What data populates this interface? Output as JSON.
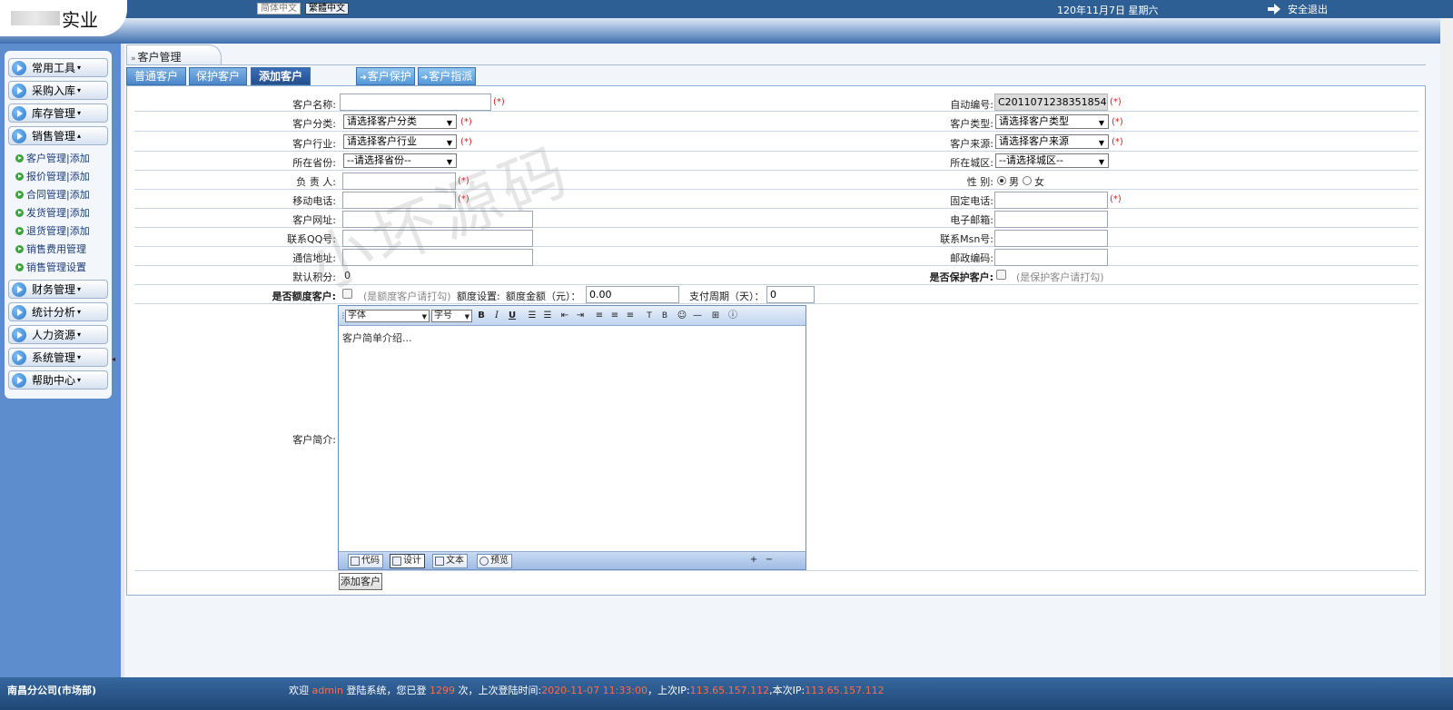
{
  "header": {
    "brand": "实业",
    "lang_simplified": "简体中文",
    "lang_traditional": "繁體中文",
    "date": "120年11月7日 星期六",
    "logout": "安全退出"
  },
  "sidebar": {
    "menus": [
      {
        "label": "常用工具",
        "caret": "▾"
      },
      {
        "label": "采购入库",
        "caret": "▾"
      },
      {
        "label": "库存管理",
        "caret": "▾"
      },
      {
        "label": "销售管理",
        "caret": "▴"
      }
    ],
    "sub_items": [
      "客户管理|添加",
      "报价管理|添加",
      "合同管理|添加",
      "发货管理|添加",
      "退货管理|添加",
      "销售费用管理",
      "销售管理设置"
    ],
    "menus_after": [
      {
        "label": "财务管理",
        "caret": "▾"
      },
      {
        "label": "统计分析",
        "caret": "▾"
      },
      {
        "label": "人力资源",
        "caret": "▾"
      },
      {
        "label": "系统管理",
        "caret": "▾"
      },
      {
        "label": "帮助中心",
        "caret": "▾"
      }
    ]
  },
  "breadcrumb": {
    "label": "客户管理"
  },
  "tabs": {
    "normal": "普通客户",
    "protected": "保护客户",
    "add": "添加客户",
    "protect": "客户保护",
    "assign": "客户指派"
  },
  "form": {
    "customer_name_label": "客户名称:",
    "auto_no_label": "自动编号:",
    "auto_no_value": "C2011071238351854",
    "category_label": "客户分类:",
    "category_value": "请选择客户分类",
    "type_label": "客户类型:",
    "type_value": "请选择客户类型",
    "industry_label": "客户行业:",
    "industry_value": "请选择客户行业",
    "source_label": "客户来源:",
    "source_value": "请选择客户来源",
    "province_label": "所在省份:",
    "province_value": "--请选择省份--",
    "city_label": "所在城区:",
    "city_value": "--请选择城区--",
    "owner_label": "负 责 人:",
    "gender_label": "性 别:",
    "gender_male": "男",
    "gender_female": "女",
    "mobile_label": "移动电话:",
    "phone_label": "固定电话:",
    "website_label": "客户网址:",
    "email_label": "电子邮箱:",
    "qq_label": "联系QQ号:",
    "msn_label": "联系Msn号:",
    "address_label": "通信地址:",
    "postcode_label": "邮政编码:",
    "points_label": "默认积分:",
    "points_value": "0",
    "is_protected_label": "是否保护客户:",
    "is_protected_hint": "(是保护客户请打勾)",
    "is_quota_label": "是否额度客户:",
    "is_quota_hint": "(是额度客户请打勾)",
    "quota_setting": "额度设置:",
    "quota_amount_label": "额度金额（元）：",
    "quota_amount_value": "0.00",
    "pay_cycle_label": "支付周期（天）：",
    "pay_cycle_value": "0",
    "intro_label": "客户简介:",
    "required": "(*)",
    "submit": "添加客户"
  },
  "editor": {
    "font": "字体",
    "size": "字号",
    "placeholder": "客户简单介绍...",
    "mode_code": "代码",
    "mode_design": "设计",
    "mode_text": "文本",
    "mode_preview": "预览"
  },
  "watermark": "小坏源码",
  "footer": {
    "company": "南昌分公司(市场部)",
    "welcome": "欢迎",
    "user": "admin",
    "login_text": "登陆系统，您已登",
    "login_count": "1299",
    "count_suffix": "次，上次登陆时间:",
    "last_time": "2020-11-07 11:33:00",
    "last_ip_label": "，上次IP:",
    "last_ip": "113.65.157.112",
    "this_ip_label": ",本次IP:",
    "this_ip": "113.65.157.112"
  },
  "colors": {
    "header": "#2d5f95",
    "sidebar": "#5d8dcc",
    "required": "#d02020",
    "footer_highlight": "#ff6a4a"
  }
}
